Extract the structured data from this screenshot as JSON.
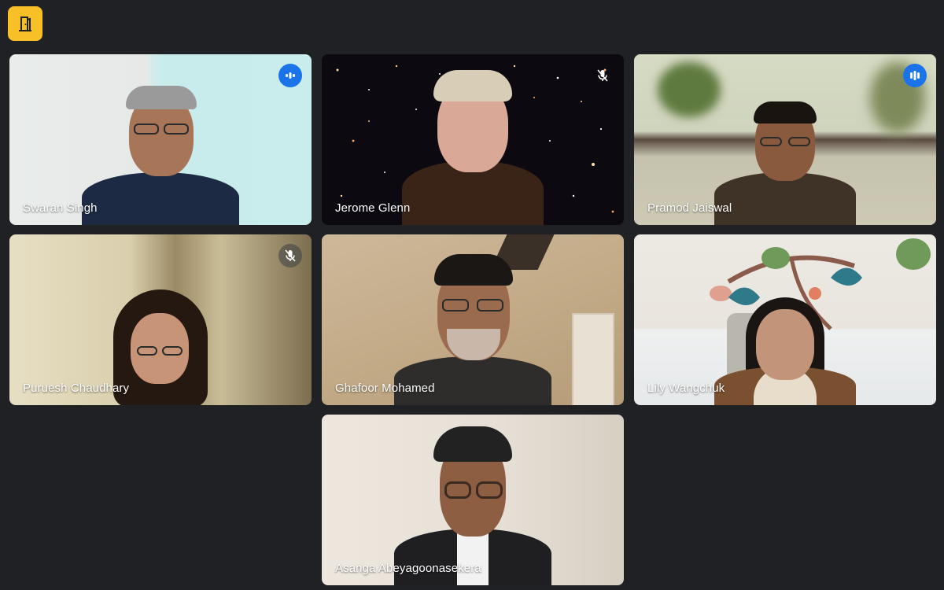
{
  "meeting": {
    "participants": [
      {
        "name": "Swaran Singh",
        "status": "speaking"
      },
      {
        "name": "Jerome Glenn",
        "status": "muted"
      },
      {
        "name": "Pramod Jaiswal",
        "status": "speaking",
        "active": true
      },
      {
        "name": "Puruesh Chaudhary",
        "status": "muted"
      },
      {
        "name": "Ghafoor Mohamed",
        "status": "none"
      },
      {
        "name": "Lily Wangchuk",
        "status": "none"
      },
      {
        "name": "Asanga Abeyagoonasekera",
        "status": "none"
      }
    ]
  },
  "icons": {
    "leave": "door-exit-icon",
    "speaking": "audio-level-icon",
    "muted": "mic-off-icon"
  },
  "colors": {
    "background": "#202124",
    "accent": "#f6c026",
    "speaking": "#1a73e8",
    "active_border": "#8ab4f8"
  }
}
